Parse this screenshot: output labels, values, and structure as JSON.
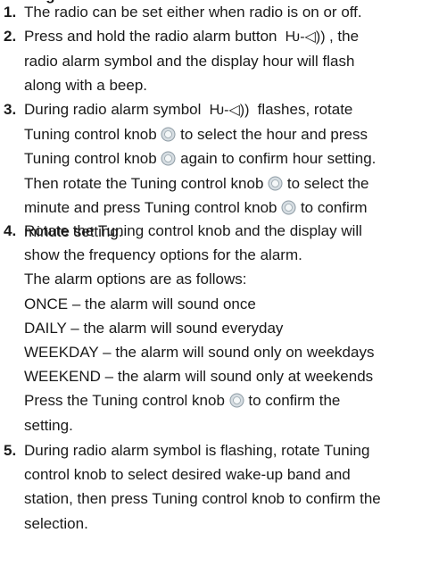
{
  "heading": "Setting",
  "alarm_symbol": "Ƕ-◁))",
  "steps": [
    {
      "num": "1.",
      "lines": [
        "The radio can be set either when radio is on or off."
      ]
    },
    {
      "num": "2.",
      "lines": [
        [
          "Press and hold the radio alarm button ",
          "{alarm}",
          ", the"
        ],
        "radio alarm symbol and the display hour will flash",
        "along with a beep."
      ]
    },
    {
      "num": "3.",
      "lines": [
        [
          "During radio alarm symbol ",
          "{alarm}",
          " flashes, rotate"
        ],
        [
          "Tuning control knob ",
          "{knob}",
          " to select the hour and press"
        ],
        [
          "Tuning control knob ",
          "{knob}",
          " again to confirm hour setting."
        ],
        [
          "Then rotate the Tuning control knob ",
          "{knob}",
          " to select the"
        ],
        [
          "minute and press Tuning control knob ",
          "{knob}",
          " to confirm"
        ],
        "minute setting."
      ]
    },
    {
      "num": "4.",
      "lines": [
        "Rotate the Tuning control knob and the display will",
        "show the frequency options for the alarm.",
        "The alarm options are as follows:",
        "ONCE – the alarm will sound once",
        "DAILY – the alarm will sound everyday",
        "WEEKDAY – the alarm will sound only on weekdays",
        "WEEKEND – the alarm will sound only at weekends",
        [
          "Press the Tuning control knob ",
          "{knob}",
          " to confirm the"
        ],
        "setting."
      ]
    },
    {
      "num": "5.",
      "lines": [
        "During radio alarm symbol is flashing, rotate Tuning",
        "control knob to select desired wake-up band and",
        "station, then press Tuning control knob to confirm the",
        "selection."
      ]
    }
  ]
}
